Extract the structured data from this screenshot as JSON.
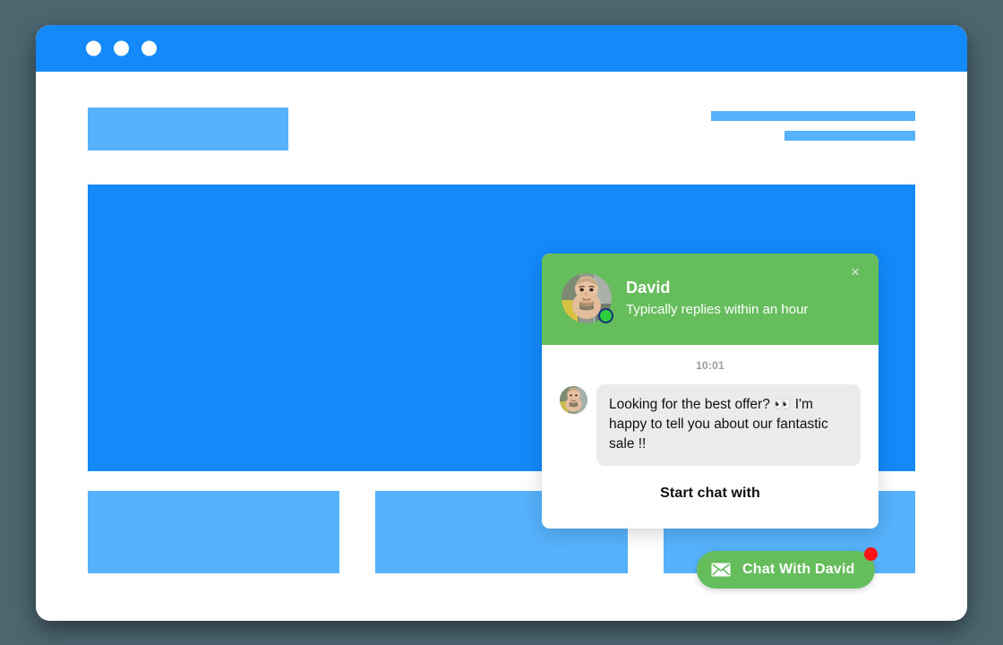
{
  "window": {
    "name": "browser-window",
    "controls": [
      "close",
      "minimize",
      "maximize"
    ]
  },
  "page_skeleton": {
    "logo_placeholder": "",
    "nav_line_1": "",
    "nav_line_2": "",
    "hero_placeholder": "",
    "cards": [
      "",
      "",
      ""
    ]
  },
  "chat_widget": {
    "close_label": "×",
    "agent_name": "David",
    "agent_status": "Typically replies within an hour",
    "presence": "online",
    "timestamp": "10:01",
    "messages": [
      {
        "sender": "David",
        "text": "Looking for the best offer? 👀 I'm happy to tell you about our fantastic sale !!",
        "time": "10:01"
      }
    ],
    "footer_label": "Start chat with"
  },
  "launcher": {
    "label": "Chat With David",
    "icon": "envelope-icon",
    "badge": true
  },
  "colors": {
    "page_background": "#4c6670",
    "title_bar": "#1389fa",
    "hero_blue": "#1389fa",
    "placeholder_blue": "#55b2fb",
    "brand_green": "#66bd5c",
    "bubble_gray": "#ebebeb",
    "badge_red": "#fc1414",
    "status_green": "#2ecc3f",
    "status_ring": "#18347a"
  }
}
